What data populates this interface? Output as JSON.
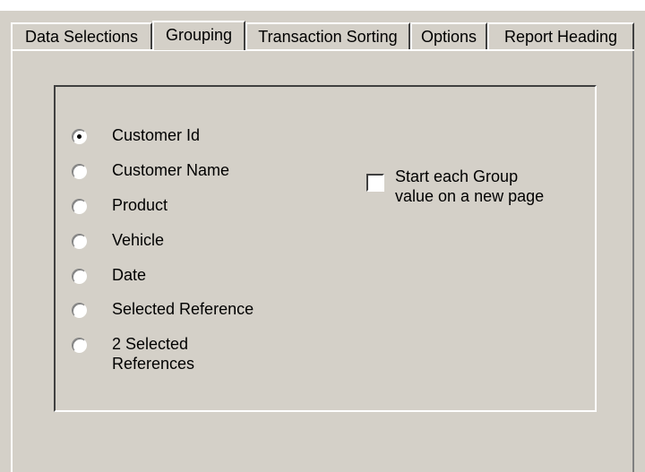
{
  "tabs": [
    {
      "label": "Data Selections",
      "active": false
    },
    {
      "label": "Grouping",
      "active": true
    },
    {
      "label": "Transaction Sorting",
      "active": false
    },
    {
      "label": "Options",
      "active": false
    },
    {
      "label": "Report Heading",
      "active": false
    }
  ],
  "grouping": {
    "options": [
      {
        "label": "Customer Id",
        "checked": true
      },
      {
        "label": "Customer Name",
        "checked": false
      },
      {
        "label": "Product",
        "checked": false
      },
      {
        "label": "Vehicle",
        "checked": false
      },
      {
        "label": "Date",
        "checked": false
      },
      {
        "label": "Selected Reference",
        "checked": false
      },
      {
        "label_line1": "2 Selected",
        "label_line2": "References",
        "checked": false
      }
    ],
    "new_page_checkbox": {
      "label_line1": "Start each Group",
      "label_line2": "value on a new page",
      "checked": false
    }
  }
}
